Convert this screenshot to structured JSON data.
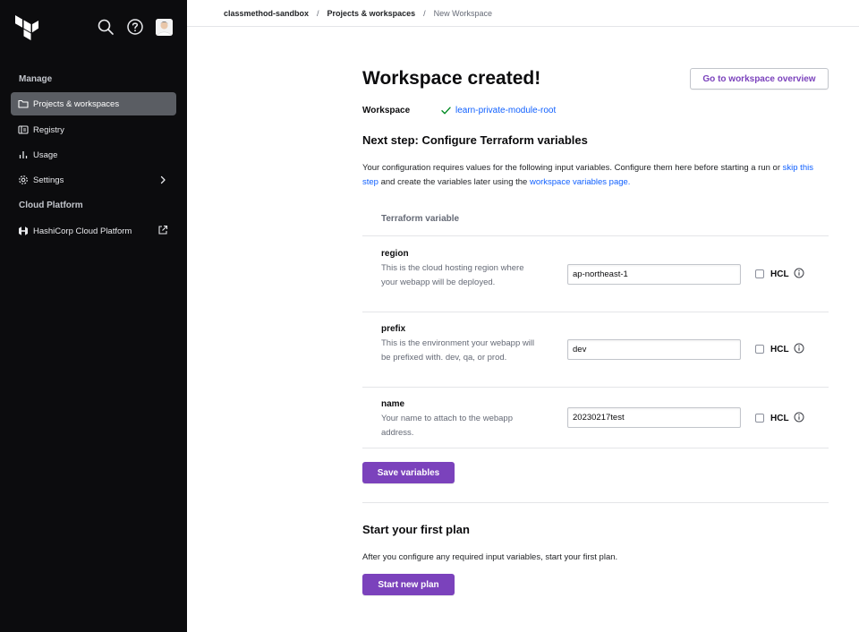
{
  "breadcrumb": {
    "items": [
      "classmethod-sandbox",
      "Projects & workspaces",
      "New Workspace"
    ],
    "separator": "/"
  },
  "sidebar": {
    "logo_icon": "terraform-logo-icon",
    "sections": [
      {
        "label": "Manage"
      },
      {
        "label": "Cloud Platform"
      }
    ],
    "items": [
      {
        "label": "Projects & workspaces",
        "icon": "folder-icon",
        "active": true
      },
      {
        "label": "Registry",
        "icon": "registry-icon"
      },
      {
        "label": "Usage",
        "icon": "bar-chart-icon"
      },
      {
        "label": "Settings",
        "icon": "gear-icon",
        "trailing_icon": "chevron-right-icon"
      },
      {
        "label": "HashiCorp Cloud Platform",
        "icon": "hashicorp-logo-icon",
        "trailing_icon": "external-link-icon"
      }
    ]
  },
  "main": {
    "title": "Workspace created!",
    "overview_button": "Go to workspace overview",
    "workspace_label": "Workspace",
    "workspace_name": "learn-private-module-root",
    "next_step_title": "Next step: Configure Terraform variables",
    "intro_part1": "Your configuration requires values for the following input variables. Configure them here before starting a run or",
    "intro_link1": "skip this step",
    "intro_part2": "and create the variables later using the",
    "intro_link2": "workspace variables page.",
    "table_header": "Terraform variable",
    "hcl_label": "HCL",
    "variables": [
      {
        "name": "region",
        "description": "This is the cloud hosting region where your webapp will be deployed.",
        "value": "ap-northeast-1"
      },
      {
        "name": "prefix",
        "description": "This is the environment your webapp will be prefixed with. dev, qa, or prod.",
        "value": "dev"
      },
      {
        "name": "name",
        "description": "Your name to attach to the webapp address.",
        "value": "20230217test"
      }
    ],
    "save_button": "Save variables",
    "plan_title": "Start your first plan",
    "plan_text": "After you configure any required input variables, start your first plan.",
    "plan_button": "Start new plan"
  },
  "colors": {
    "sidebar_bg": "#0c0c0e",
    "active_nav_bg": "#5a5d63",
    "primary": "#7b42bc",
    "link": "#1060ff",
    "success": "#008a22"
  }
}
